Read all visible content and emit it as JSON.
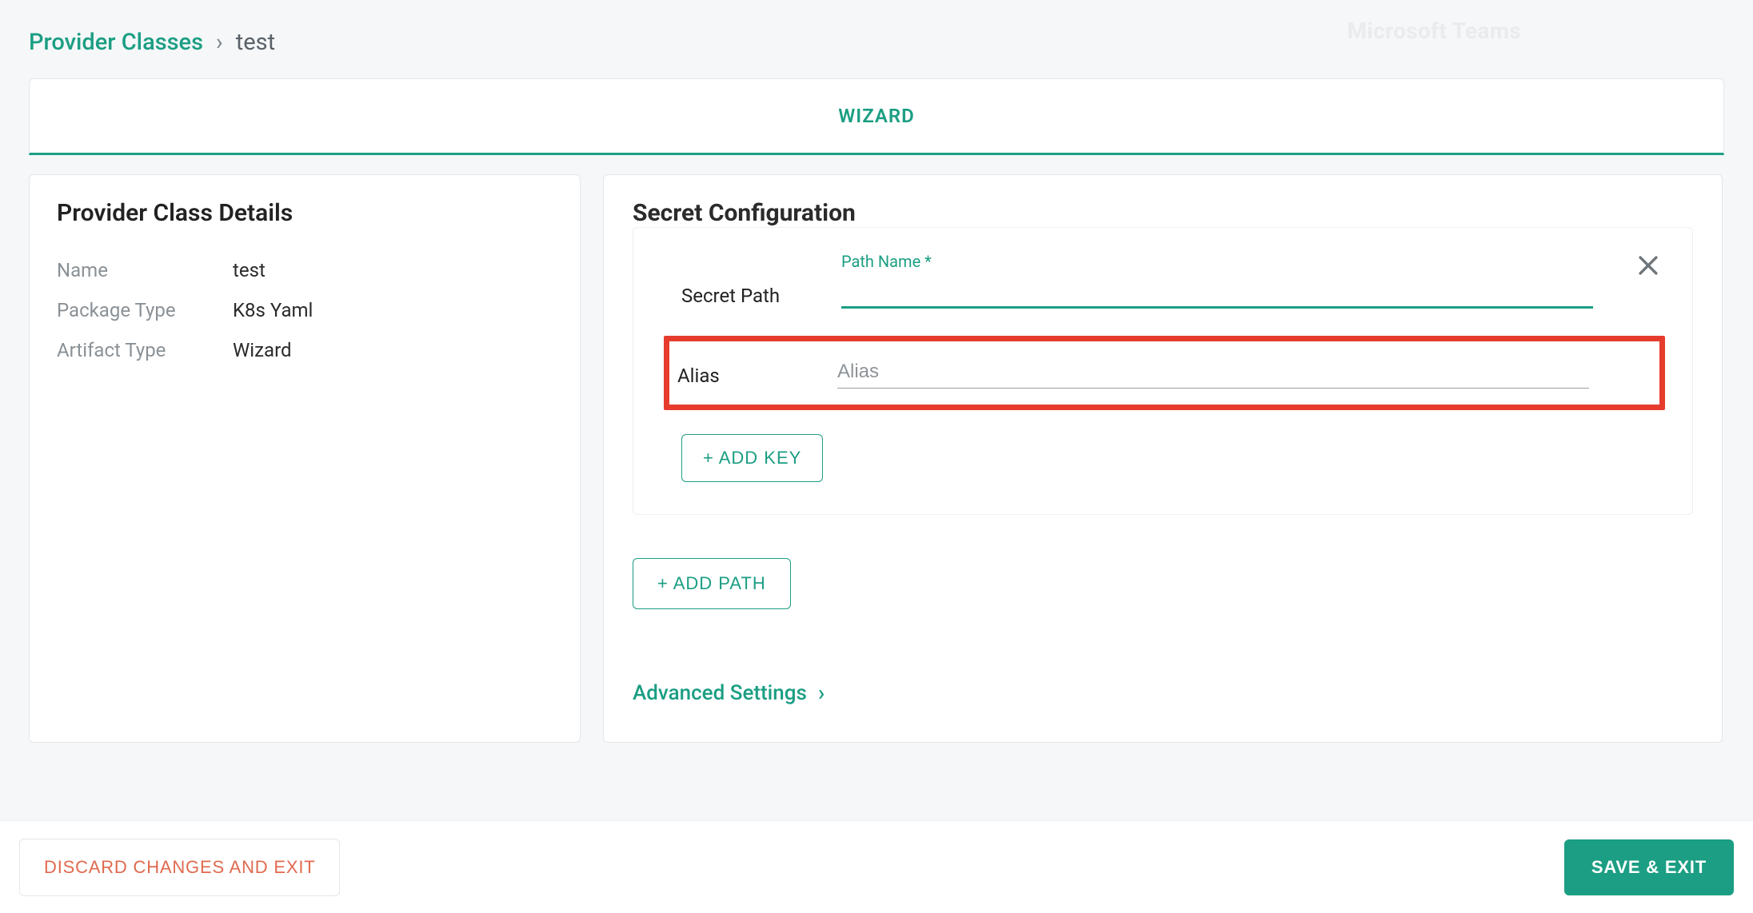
{
  "breadcrumb": {
    "root": "Provider Classes",
    "separator": "›",
    "current": "test"
  },
  "watermark": "Microsoft Teams",
  "tabs": {
    "wizard": "WIZARD"
  },
  "details": {
    "title": "Provider Class Details",
    "rows": {
      "name_label": "Name",
      "name_value": "test",
      "package_label": "Package Type",
      "package_value": "K8s Yaml",
      "artifact_label": "Artifact Type",
      "artifact_value": "Wizard"
    }
  },
  "secret": {
    "title": "Secret Configuration",
    "path": {
      "row_label": "Secret Path",
      "floating_label": "Path Name *",
      "value": ""
    },
    "alias": {
      "row_label": "Alias",
      "placeholder": "Alias",
      "value": ""
    },
    "add_key_label": "+ ADD KEY",
    "add_path_label": "+ ADD PATH",
    "advanced_label": "Advanced Settings"
  },
  "footer": {
    "discard": "DISCARD CHANGES AND EXIT",
    "save": "SAVE & EXIT"
  }
}
